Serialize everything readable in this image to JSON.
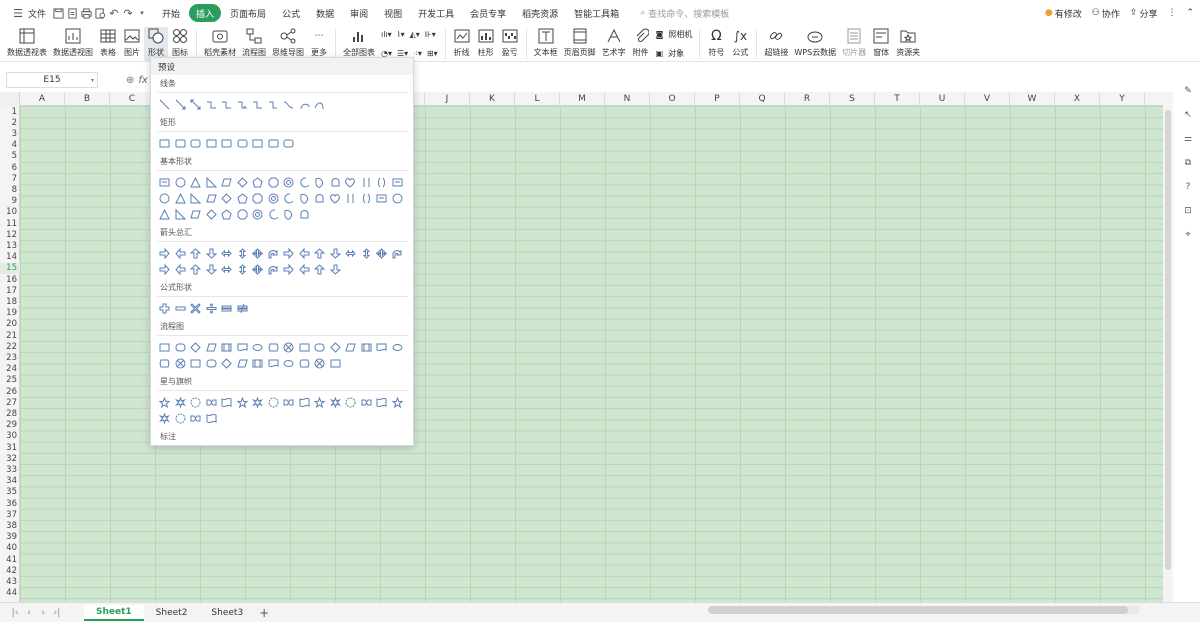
{
  "colors": {
    "accent": "#2a9d5c",
    "sheet_bg": "#cfe6cf",
    "grid_line": "#b9d6b9"
  },
  "menu": {
    "file_label": "文件",
    "quick_icons": [
      "save-icon",
      "export-pdf-icon",
      "print-icon",
      "print-preview-icon",
      "undo-icon",
      "redo-icon",
      "more-chevron-icon"
    ],
    "tabs": [
      {
        "label": "开始",
        "active": false
      },
      {
        "label": "插入",
        "active": true
      },
      {
        "label": "页面布局",
        "active": false
      },
      {
        "label": "公式",
        "active": false
      },
      {
        "label": "数据",
        "active": false
      },
      {
        "label": "审阅",
        "active": false
      },
      {
        "label": "视图",
        "active": false
      },
      {
        "label": "开发工具",
        "active": false
      },
      {
        "label": "会员专享",
        "active": false
      },
      {
        "label": "稻壳资源",
        "active": false
      },
      {
        "label": "智能工具箱",
        "active": false
      }
    ],
    "search_placeholder": "查找命令、搜索模板",
    "right": {
      "changes": "有修改",
      "collab": "协作",
      "share": "分享"
    }
  },
  "ribbon": {
    "pivot_table": "数据透视表",
    "pivot_chart": "数据透视图",
    "table": "表格",
    "picture": "图片",
    "shape": "形状",
    "icon": "图标",
    "docer_material": "稻壳素材",
    "flowchart": "流程图",
    "mindmap": "思维导图",
    "more": "更多",
    "all_charts": "全部图表",
    "line": "折线",
    "column": "柱形",
    "win_loss": "盈亏",
    "textbox": "文本框",
    "header_footer": "页眉页脚",
    "wordart": "艺术字",
    "attachment": "附件",
    "camera": "照相机",
    "object": "对象",
    "symbol": "符号",
    "formula": "公式",
    "hyperlink": "超链接",
    "wps_cloud": "WPS云数据",
    "slicer": "切片器",
    "form": "窗体",
    "resource": "资源夹"
  },
  "formula_bar": {
    "cell_ref": "E15",
    "fx": "fx"
  },
  "columns": [
    "A",
    "B",
    "C",
    "D",
    "E",
    "F",
    "G",
    "H",
    "I",
    "J",
    "K",
    "L",
    "M",
    "N",
    "O",
    "P",
    "Q",
    "R",
    "S",
    "T",
    "U",
    "V",
    "W",
    "X",
    "Y"
  ],
  "selected_row": 15,
  "row_count": 44,
  "dropdown": {
    "preset": "预设",
    "sections": [
      {
        "title": "线条",
        "count": 11
      },
      {
        "title": "矩形",
        "count": 9
      },
      {
        "title": "基本形状",
        "count": 42
      },
      {
        "title": "箭头总汇",
        "count": 28
      },
      {
        "title": "公式形状",
        "count": 6
      },
      {
        "title": "流程图",
        "count": 28
      },
      {
        "title": "星与旗帜",
        "count": 20
      },
      {
        "title": "标注",
        "count": 16
      }
    ]
  },
  "sheets": [
    {
      "label": "Sheet1",
      "active": true
    },
    {
      "label": "Sheet2",
      "active": false
    },
    {
      "label": "Sheet3",
      "active": false
    }
  ],
  "add_sheet": "+"
}
